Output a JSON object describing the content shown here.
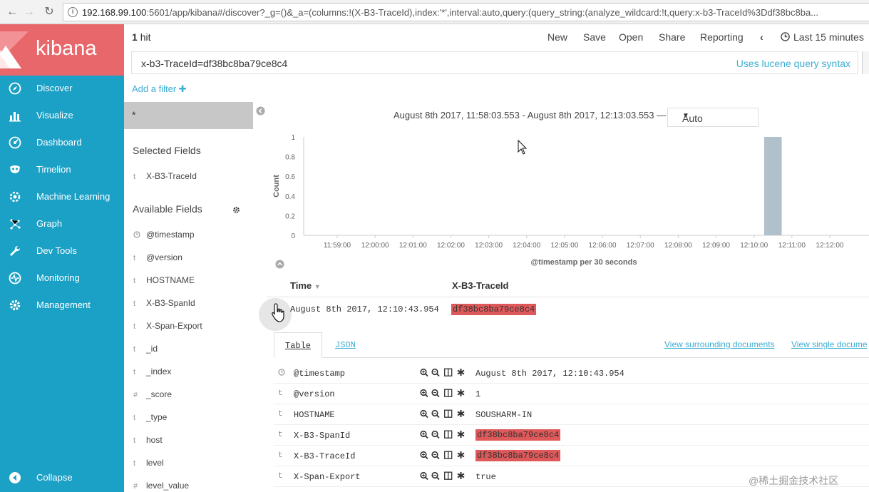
{
  "browser": {
    "url_host": "192.168.99.100",
    "url_rest": ":5601/app/kibana#/discover?_g=()&_a=(columns:!(X-B3-TraceId),index:'*',interval:auto,query:(query_string:(analyze_wildcard:!t,query:x-b3-TraceId%3Ddf38bc8ba..."
  },
  "sidebar": {
    "brand": "kibana",
    "items": [
      {
        "label": "Discover",
        "icon": "compass-icon"
      },
      {
        "label": "Visualize",
        "icon": "bar-chart-icon"
      },
      {
        "label": "Dashboard",
        "icon": "dashboard-icon"
      },
      {
        "label": "Timelion",
        "icon": "timelion-mask-icon"
      },
      {
        "label": "Machine Learning",
        "icon": "machine-learning-icon"
      },
      {
        "label": "Graph",
        "icon": "graph-icon"
      },
      {
        "label": "Dev Tools",
        "icon": "wrench-icon"
      },
      {
        "label": "Monitoring",
        "icon": "heartbeat-icon"
      },
      {
        "label": "Management",
        "icon": "gear-icon"
      }
    ],
    "collapse": "Collapse"
  },
  "toolbar": {
    "hits_count": "1",
    "hits_label": "hit",
    "menu": [
      "New",
      "Save",
      "Open",
      "Share",
      "Reporting"
    ],
    "time_label": "Last 15 minutes"
  },
  "query": {
    "value": "x-b3-TraceId=df38bc8ba79ce8c4",
    "hint": "Uses lucene query syntax"
  },
  "filter": {
    "add_label": "Add a filter"
  },
  "fields": {
    "index_pattern": "*",
    "selected_title": "Selected Fields",
    "selected": [
      {
        "type": "t",
        "name": "X-B3-TraceId"
      }
    ],
    "available_title": "Available Fields",
    "available": [
      {
        "type": "clock",
        "name": "@timestamp"
      },
      {
        "type": "t",
        "name": "@version"
      },
      {
        "type": "t",
        "name": "HOSTNAME"
      },
      {
        "type": "t",
        "name": "X-B3-SpanId"
      },
      {
        "type": "t",
        "name": "X-Span-Export"
      },
      {
        "type": "t",
        "name": "_id"
      },
      {
        "type": "t",
        "name": "_index"
      },
      {
        "type": "#",
        "name": "_score"
      },
      {
        "type": "t",
        "name": "_type"
      },
      {
        "type": "t",
        "name": "host"
      },
      {
        "type": "t",
        "name": "level"
      },
      {
        "type": "#",
        "name": "level_value"
      }
    ]
  },
  "histogram": {
    "range_text": "August 8th 2017, 11:58:03.553 - August 8th 2017, 12:13:03.553 —",
    "interval": "Auto"
  },
  "chart_data": {
    "type": "bar",
    "ylabel": "Count",
    "xlabel": "@timestamp per 30 seconds",
    "ylim": [
      0,
      1
    ],
    "yticks": [
      "0",
      "0.2",
      "0.4",
      "0.6",
      "0.8",
      "1"
    ],
    "categories": [
      "11:59:00",
      "12:00:00",
      "12:01:00",
      "12:02:00",
      "12:03:00",
      "12:04:00",
      "12:05:00",
      "12:06:00",
      "12:07:00",
      "12:08:00",
      "12:09:00",
      "12:10:00",
      "12:11:00",
      "12:12:00"
    ],
    "bars": [
      {
        "x": "12:10:30",
        "value": 1
      }
    ],
    "color": "#b0c1cb"
  },
  "doc_table": {
    "col_time": "Time",
    "col_field": "X-B3-TraceId",
    "row_time": "August 8th 2017, 12:10:43.954",
    "row_value": "df38bc8ba79ce8c4"
  },
  "detail": {
    "tab_table": "Table",
    "tab_json": "JSON",
    "link_surrounding": "View surrounding documents",
    "link_single": "View single docume",
    "rows": [
      {
        "type": "clock",
        "name": "@timestamp",
        "value": "August 8th 2017, 12:10:43.954",
        "highlight": false
      },
      {
        "type": "t",
        "name": "@version",
        "value": "1",
        "highlight": false
      },
      {
        "type": "t",
        "name": "HOSTNAME",
        "value": "SOUSHARM-IN",
        "highlight": false
      },
      {
        "type": "t",
        "name": "X-B3-SpanId",
        "value": "df38bc8ba79ce8c4",
        "highlight": true
      },
      {
        "type": "t",
        "name": "X-B3-TraceId",
        "value": "df38bc8ba79ce8c4",
        "highlight": true
      },
      {
        "type": "t",
        "name": "X-Span-Export",
        "value": "true",
        "highlight": false
      }
    ]
  },
  "watermark": "@稀土掘金技术社区",
  "colors": {
    "sidebar": "#1ba0c6",
    "logo": "#e8676b",
    "link": "#3caed2",
    "highlight": "#e0595a"
  }
}
